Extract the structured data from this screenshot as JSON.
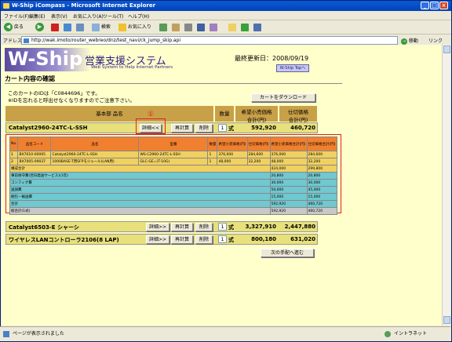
{
  "window": {
    "title": "W-Ship iCompass - Microsoft Internet Explorer"
  },
  "menu": [
    "ファイル(F)",
    "編集(E)",
    "表示(V)",
    "お気に入り(A)",
    "ツール(T)",
    "ヘルプ(H)"
  ],
  "toolbar": {
    "back": "戻る",
    "search": "検索",
    "favorites": "お気に入り"
  },
  "address": {
    "label": "アドレス(D)",
    "url": "http://wak.imoto/router_webreo/dnz/test_navi/ck_jump_skip.api",
    "go": "移動",
    "links": "リンク"
  },
  "page": {
    "logo_main": "W-Ship",
    "logo_jp": "営業支援システム",
    "logo_sub": "Web System to Help Internet Partners",
    "updated": "最終更新日：2008/09/19",
    "top_button": "W-Ship Topへ",
    "heading": "カート内容の確認",
    "info_line1": "このカートのIDは「C0844696」です。",
    "info_line2": "※IDを忘れると呼出せなくなりますのでご注意下さい。",
    "download_button": "カートをダウンロード",
    "col_base": "基本部 品名",
    "col_qty": "数量",
    "col_price_line1": "希望小売価格",
    "col_price_line2": "合計(円)",
    "col_cost_line1": "仕切価格",
    "col_cost_line2": "合計(円)",
    "detail_close": "詳細<<",
    "detail_open": "詳細>>",
    "recalc": "再計算",
    "delete": "削除",
    "unit": "式",
    "next_button": "次の手配へ進む",
    "callout1": "①",
    "callout2": "②"
  },
  "products": [
    {
      "name": "Catalyst2960-24TC-L-SSH",
      "qty": "1",
      "price": "592,920",
      "cost": "460,720"
    },
    {
      "name": "Catalyst6503-E シャーシ",
      "qty": "1",
      "price": "3,327,910",
      "cost": "2,447,880"
    },
    {
      "name": "ワイヤレスLANコントローラ2106(8 LAP)",
      "qty": "1",
      "price": "800,180",
      "cost": "631,020"
    }
  ],
  "detail": {
    "headers": [
      "No.",
      "品名コード",
      "品名",
      "型番",
      "数量",
      "希望小売価格(円)",
      "仕切価格(円)",
      "希望小売価格合計(円)",
      "仕切価格合計(円)"
    ],
    "rows": [
      [
        "1",
        "BX7010-00005",
        "Catalyst2960-24TC-L-SSH",
        "WS-C2960-24TC-L-SSH",
        "1",
        "376,000",
        "284,600",
        "376,000",
        "284,600"
      ],
      [
        "2",
        "BX7005-09037",
        "1000BASE-T用SFPモジュール(LAN用)",
        "GLC-GE=(T-10G)",
        "1",
        "48,000",
        "32,200",
        "48,000",
        "32,200"
      ]
    ],
    "summary": [
      {
        "label": "構成合計",
        "price": "424,000",
        "cost": "299,800",
        "cls": "ye"
      },
      {
        "label": "事前保守費(翌日発送サービス)(1年)",
        "price": "20,800",
        "cost": "20,800",
        "cls": "bl"
      },
      {
        "label": "コンフィグ費",
        "price": "30,000",
        "cost": "30,000",
        "cls": "bl"
      },
      {
        "label": "送調費",
        "price": "50,000",
        "cost": "45,000",
        "cls": "bl"
      },
      {
        "label": "梱包・輸送費",
        "price": "15,000",
        "cost": "15,000",
        "cls": "bl"
      },
      {
        "label": "合計",
        "price": "592,920",
        "cost": "460,720",
        "cls": "bl"
      },
      {
        "label": "総合計(1式)",
        "price": "592,920",
        "cost": "460,720",
        "cls": "gy"
      }
    ]
  },
  "status": {
    "text": "ページが表示されました",
    "zone": "イントラネット"
  },
  "colors": {
    "title_bar": "#0442b8",
    "page_bg": "#ffffcc",
    "header": "#c8a048",
    "detail_header": "#f08030",
    "highlight": "#e02020"
  }
}
